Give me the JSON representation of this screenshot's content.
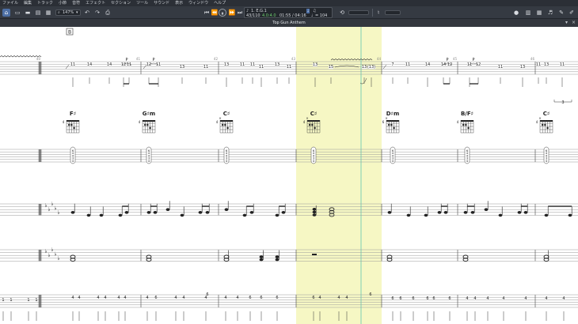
{
  "menu": [
    "ファイル",
    "編集",
    "トラック",
    "小節",
    "音符",
    "エフェクト",
    "セクション",
    "ツール",
    "サウンド",
    "表示",
    "ウィンドウ",
    "ヘルプ"
  ],
  "toolbar": {
    "zoom": "147%",
    "track_name": "1. E.G.1",
    "bar_position": "43/110",
    "time_signature": "4.0:4.0",
    "time_position": "01:55 / 04:16",
    "tempo": "= 104",
    "tempo_prefix": "♩"
  },
  "score": {
    "title": "Top Gun Anthem",
    "section_marker": "B",
    "bar_numbers": [
      "40",
      "41",
      "42",
      "43",
      "44",
      "45",
      "46"
    ],
    "tab_fret_rows": [
      [
        "11",
        "14",
        "14",
        "12",
        "11",
        "12",
        "11",
        "13",
        "11",
        "13",
        "11",
        "11",
        "11",
        "13",
        "11",
        "13",
        "15",
        "13",
        "(13)",
        "7",
        "11",
        "14",
        "14",
        "12",
        "11",
        "12",
        "11",
        "13",
        "11",
        "13",
        "11",
        "11"
      ]
    ],
    "palm_mute_labels": [
      "P",
      "P",
      "P",
      "P",
      "P",
      "P"
    ],
    "chords": [
      {
        "name": "F♯",
        "fret": "4"
      },
      {
        "name": "G♯m",
        "fret": "4"
      },
      {
        "name": "C♯",
        "fret": "4"
      },
      {
        "name": "C♯",
        "fret": "4"
      },
      {
        "name": "D♯m",
        "fret": "6"
      },
      {
        "name": "B/F♯",
        "fret": "4"
      },
      {
        "name": "C♯",
        "fret": "4"
      }
    ],
    "chord_tab_frets": [
      "6",
      "4",
      "4",
      "3",
      "4"
    ],
    "bass_frets": [
      "1",
      "1",
      "1",
      "1",
      "4",
      "4",
      "4",
      "4",
      "4",
      "4",
      "4",
      "6",
      "4",
      "4",
      "4",
      "4",
      "4",
      "6",
      "6",
      "6",
      "6",
      "4",
      "4",
      "4"
    ],
    "triplet_mark": "3"
  }
}
